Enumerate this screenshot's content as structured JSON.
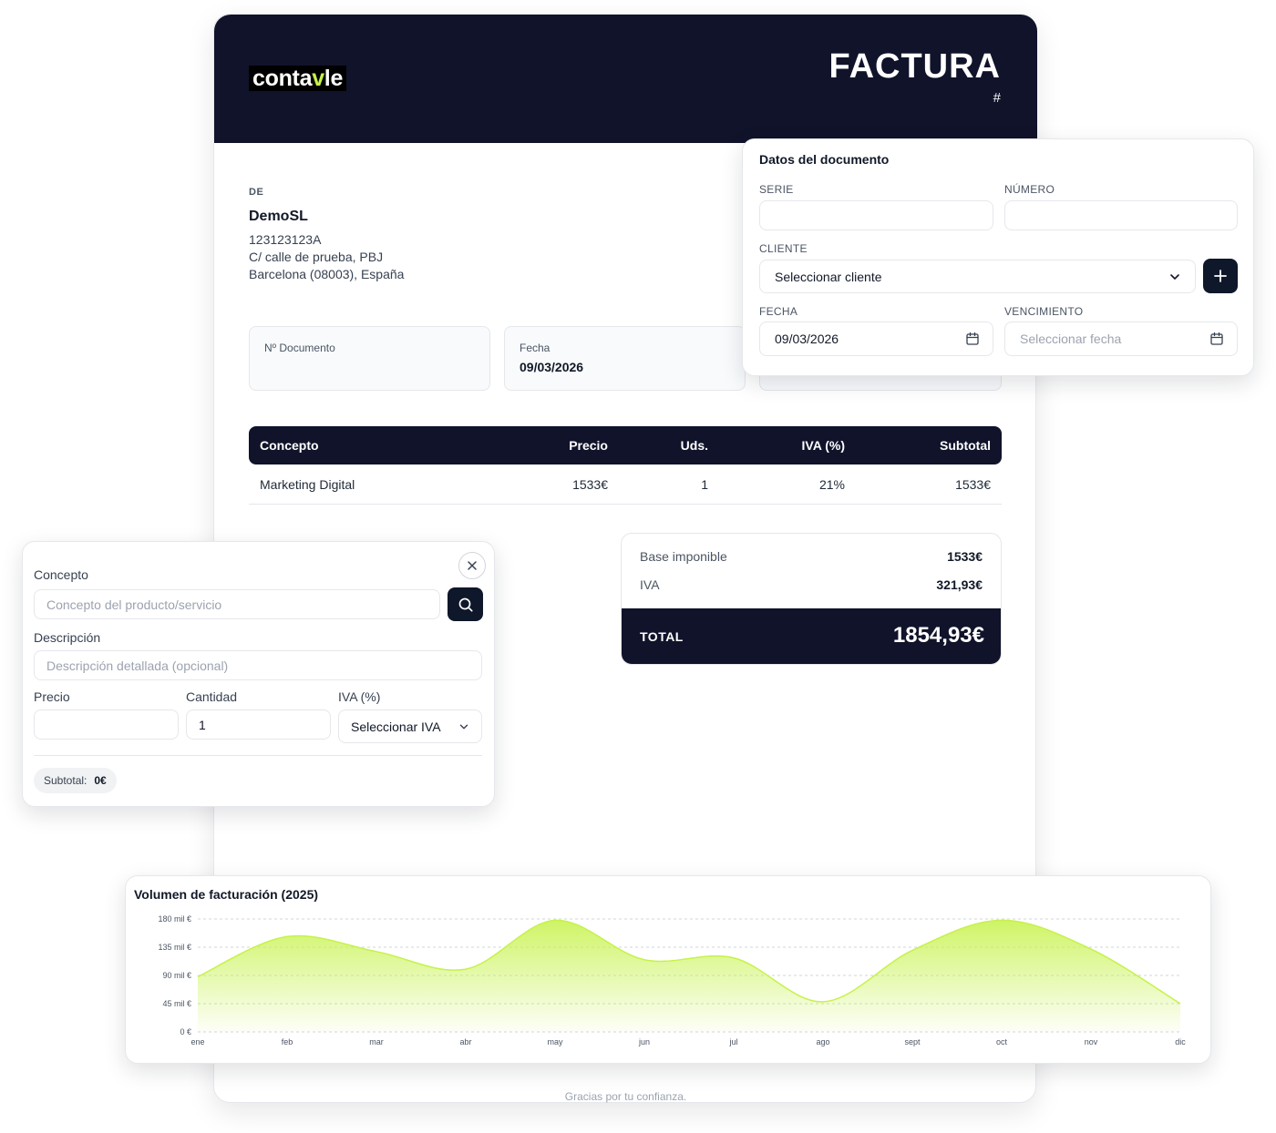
{
  "invoice": {
    "logo": {
      "part1": "conta",
      "part2": "v",
      "part3": "le"
    },
    "title": "FACTURA",
    "hash": "#",
    "from_label": "DE",
    "from_name": "DemoSL",
    "from_lines": [
      "123123123A",
      "C/ calle de prueba, PBJ",
      "Barcelona (08003), España"
    ],
    "meta": {
      "doc_number_label": "Nº Documento",
      "doc_number_value": "",
      "date_label": "Fecha",
      "date_value": "09/03/2026"
    },
    "items": {
      "headers": {
        "concept": "Concepto",
        "price": "Precio",
        "units": "Uds.",
        "vat": "IVA (%)",
        "subtotal": "Subtotal"
      },
      "rows": [
        {
          "concept": "Marketing Digital",
          "price": "1533€",
          "units": "1",
          "vat": "21%",
          "subtotal": "1533€"
        }
      ]
    },
    "totals": {
      "base_label": "Base imponible",
      "base_value": "1533€",
      "vat_label": "IVA",
      "vat_value": "321,93€",
      "total_label": "TOTAL",
      "total_value": "1854,93€"
    },
    "footer": "Gracias por tu confianza."
  },
  "doc_card": {
    "title": "Datos del documento",
    "serie_label": "SERIE",
    "serie_value": "",
    "numero_label": "NÚMERO",
    "numero_value": "",
    "cliente_label": "CLIENTE",
    "cliente_value": "Seleccionar cliente",
    "fecha_label": "FECHA",
    "fecha_value": "09/03/2026",
    "vencimiento_label": "VENCIMIENTO",
    "vencimiento_placeholder": "Seleccionar fecha"
  },
  "concept_card": {
    "concepto_label": "Concepto",
    "concepto_placeholder": "Concepto del producto/servicio",
    "descripcion_label": "Descripción",
    "descripcion_placeholder": "Descripción detallada (opcional)",
    "precio_label": "Precio",
    "precio_value": "",
    "cantidad_label": "Cantidad",
    "cantidad_value": "1",
    "iva_label": "IVA (%)",
    "iva_value": "Seleccionar IVA",
    "subtotal_label": "Subtotal:",
    "subtotal_value": "0€"
  },
  "colors": {
    "navy": "#10132a",
    "accent": "#c6f24a"
  },
  "chart_data": {
    "type": "area",
    "title": "Volumen de facturación (2025)",
    "categories": [
      "ene",
      "feb",
      "mar",
      "abr",
      "may",
      "jun",
      "jul",
      "ago",
      "sept",
      "oct",
      "nov",
      "dic"
    ],
    "series": [
      {
        "values": [
          88000,
          152000,
          128000,
          100000,
          178000,
          115000,
          118000,
          48000,
          130000,
          178000,
          132000,
          45000
        ]
      }
    ],
    "yticks": [
      0,
      45000,
      90000,
      135000,
      180000
    ],
    "ytick_labels": [
      "0 €",
      "45 mil €",
      "90 mil €",
      "135 mil €",
      "180 mil €"
    ],
    "ylim": [
      0,
      180000
    ],
    "grid": true
  }
}
